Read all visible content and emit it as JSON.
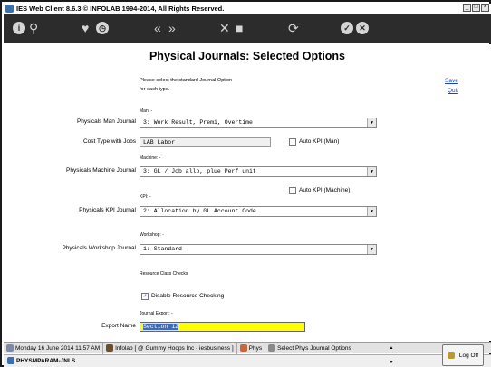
{
  "window": {
    "title": "IES Web Client 8.6.3 © INFOLAB 1994-2014, All Rights Reserved.",
    "buttons": [
      "_",
      "□",
      "×"
    ]
  },
  "toolbar": {
    "icons": [
      "info-icon",
      "search-icon",
      "favorite-icon",
      "history-icon",
      "back-icon",
      "forward-icon",
      "tools-icon",
      "blank-icon",
      "refresh-icon",
      "ok-icon",
      "cancel-icon"
    ]
  },
  "page": {
    "title": "Physical Journals: Selected Options",
    "instructions_line1": "Please select the standard Journal Option",
    "instructions_line2": "for each type.",
    "save_link": "Save",
    "quit_link": "Quit"
  },
  "sections": {
    "man": "Man: -",
    "machine": "Machine: -",
    "kpi": "KPI: -",
    "workshop": "Workshop: -",
    "resource_class": "Resource Class Checks",
    "journal_export": "Journal Export: -"
  },
  "fields": {
    "man_journal_label": "Physicals Man Journal",
    "man_journal_value": "3: Work Result, Premi, Overtime",
    "cost_type_label": "Cost Type with Jobs",
    "cost_type_value": "LAB Labor",
    "auto_kpi_man_label": "Auto KPI (Man)",
    "machine_journal_label": "Physicals Machine Journal",
    "machine_journal_value": "3: GL / Job allo, plue Perf unit",
    "auto_kpi_machine_label": "Auto KPI (Machine)",
    "kpi_journal_label": "Physicals KPI Journal",
    "kpi_journal_value": "2: Allocation by GL Account Code",
    "workshop_journal_label": "Physicals Workshop Journal",
    "workshop_journal_value": "1: Standard",
    "disable_resource_label": "Disable Resource Checking",
    "disable_resource_checked": true,
    "export_name_label": "Export Name",
    "export_name_value": "Section 12"
  },
  "status": {
    "datetime": "Monday 16 June 2014 11:57 AM",
    "user": "Infolab [ @ Gummy Hoops Inc - iesbusiness ]",
    "module": "Phys",
    "screen": "Select Phys Journal Options",
    "task": "PHYSMPARAM-JNLS",
    "logoff": "Log Off"
  }
}
